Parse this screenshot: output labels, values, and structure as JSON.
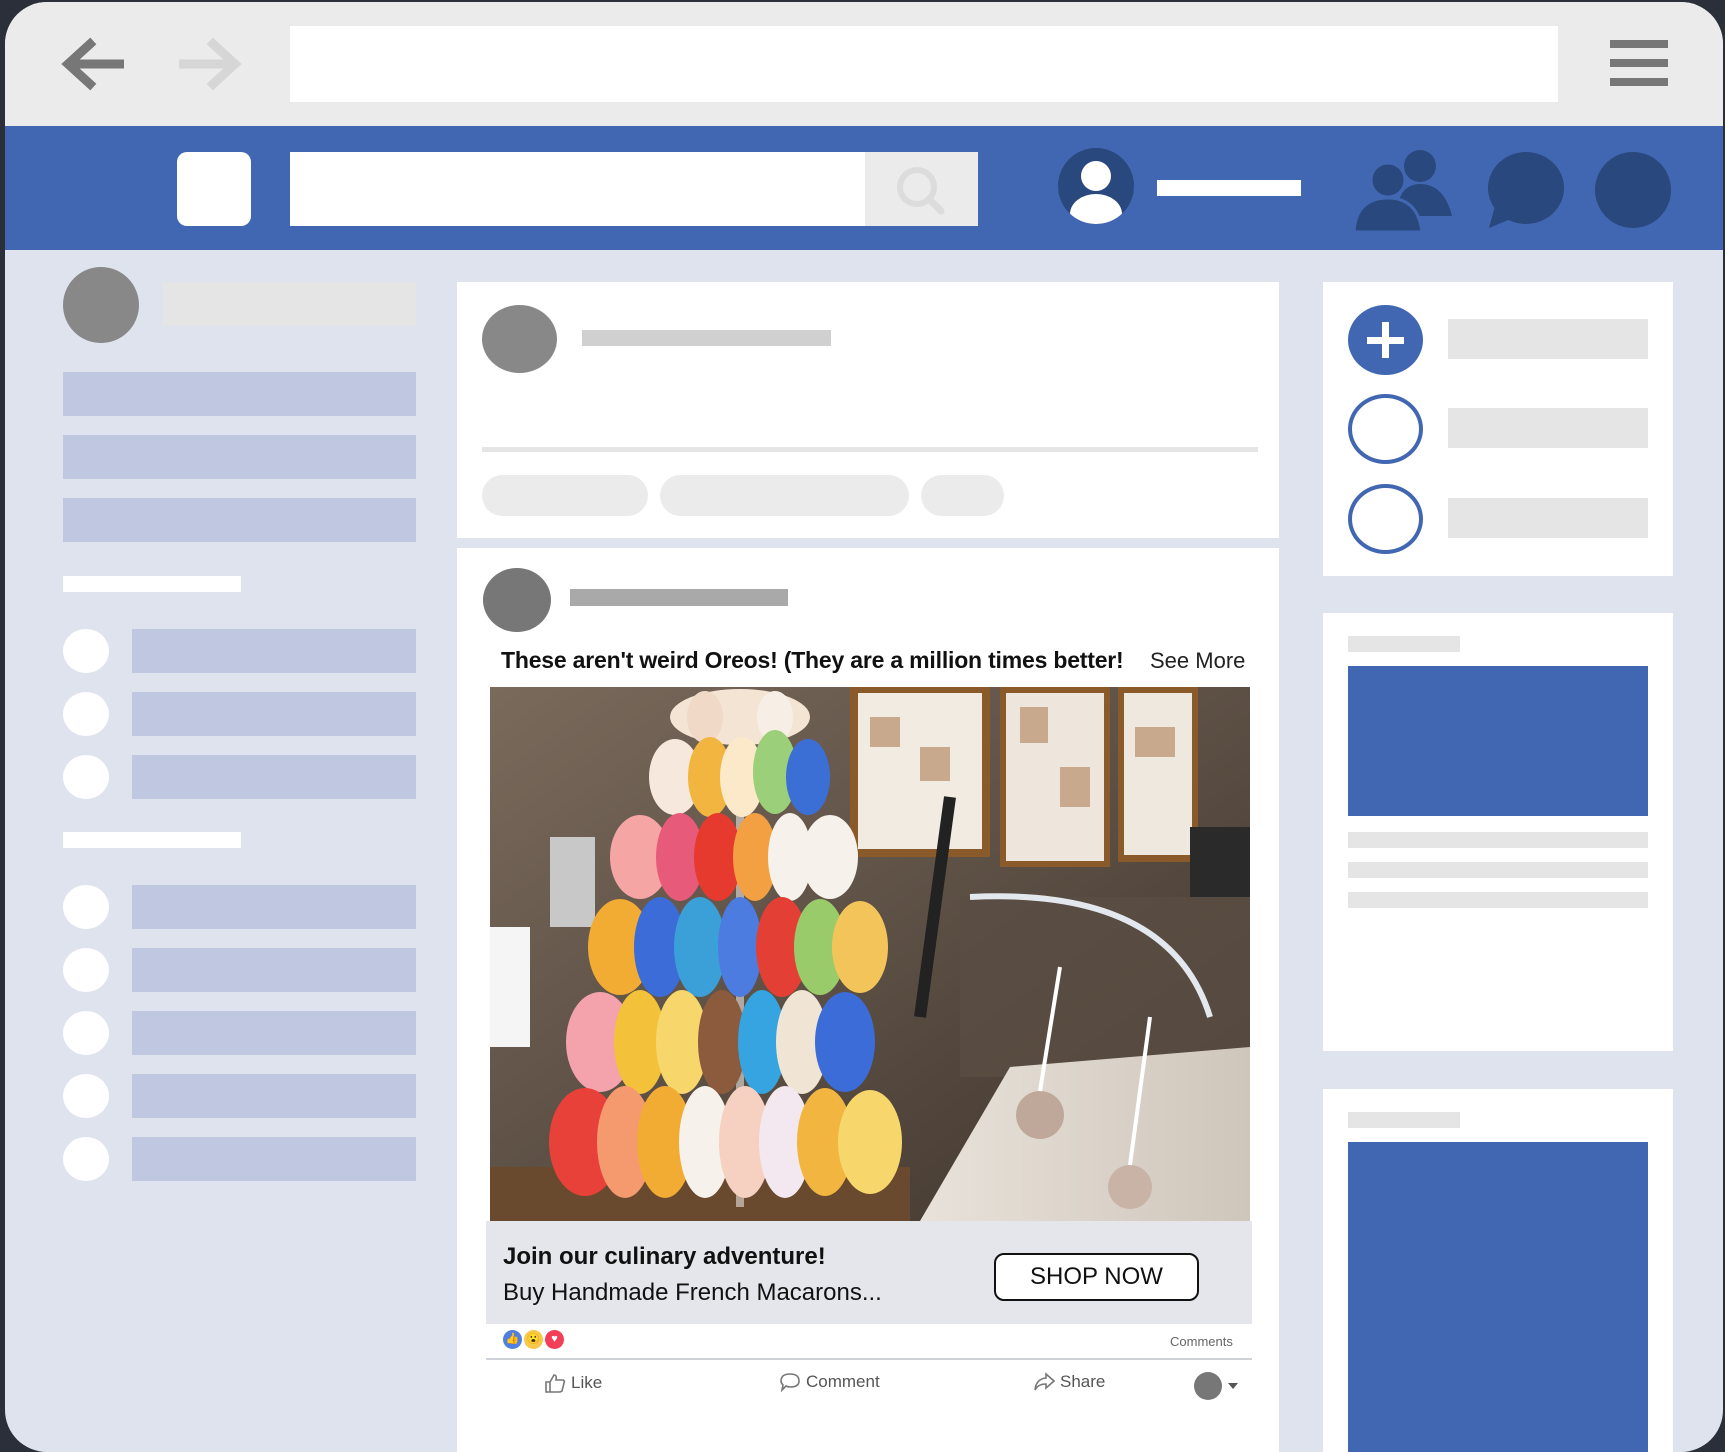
{
  "post": {
    "caption": "These aren't weird Oreos! (They are a million times better!",
    "see_more": "See More",
    "ad_title": "Join our culinary adventure!",
    "ad_subtitle": "Buy Handmade French Macarons...",
    "cta_label": "SHOP NOW",
    "comments_label": "Comments",
    "actions": {
      "like": "Like",
      "comment": "Comment",
      "share": "Share"
    }
  },
  "icons": {
    "back": "arrow-left-icon",
    "forward": "arrow-right-icon",
    "menu": "hamburger-icon",
    "search": "search-icon",
    "friends": "friends-icon",
    "messages": "chat-bubble-icon",
    "create": "plus-icon"
  },
  "colors": {
    "brand_blue": "#4267b2",
    "dark_blue": "#29487d",
    "page_bg": "#dfe3ee",
    "placeholder_blue": "#c0c7e0"
  }
}
